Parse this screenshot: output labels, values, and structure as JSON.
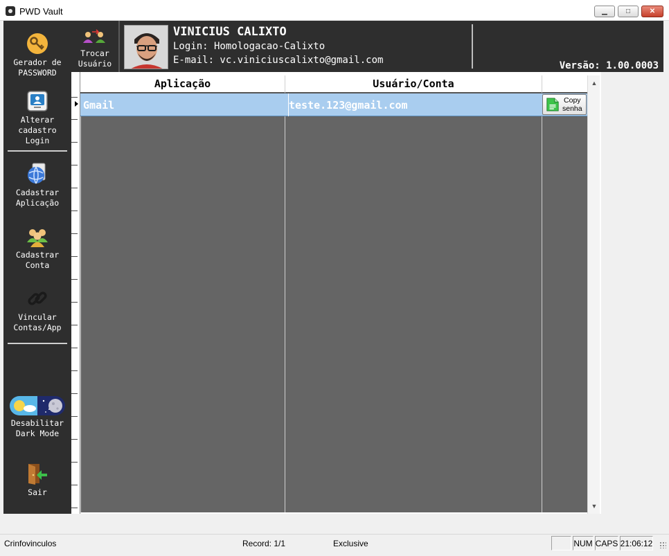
{
  "window": {
    "title": "PWD Vault",
    "minimize_glyph": "▁",
    "maximize_glyph": "□",
    "close_glyph": "✕"
  },
  "sidebar": {
    "items": [
      {
        "label": "Gerador de\nPASSWORD",
        "icon": "key-icon"
      },
      {
        "label": "Alterar\ncadastro\nLogin",
        "icon": "id-card-icon"
      },
      {
        "label": "Cadastrar\nAplicação",
        "icon": "globe-icon"
      },
      {
        "label": "Cadastrar\nConta",
        "icon": "users-icon"
      },
      {
        "label": "Vincular\nContas/App",
        "icon": "link-icon"
      },
      {
        "label": "Desabilitar\nDark Mode",
        "icon": "day-night-toggle-icon"
      },
      {
        "label": "Sair",
        "icon": "exit-door-icon"
      }
    ]
  },
  "header": {
    "switch_user_label": "Trocar\nUsuário",
    "user_name": "VINICIUS CALIXTO",
    "login": "Login: Homologacao-Calixto",
    "email": "E-mail: vc.viniciuscalixto@gmail.com",
    "version": "Versão: 1.00.0003"
  },
  "grid": {
    "columns": [
      "Aplicação",
      "Usuário/Conta"
    ],
    "rows": [
      {
        "application": "Gmail",
        "account": "teste.123@gmail.com",
        "action_label": "Copy\nsenha"
      }
    ]
  },
  "statusbar": {
    "left": "Crinfovinculos",
    "record": "Record: 1/1",
    "mode": "Exclusive",
    "num": "NUM",
    "caps": "CAPS",
    "time": "21:06:12"
  },
  "colors": {
    "dark_bg": "#2e2e2e",
    "grid_bg": "#656565",
    "selection": "#a9cdef"
  }
}
